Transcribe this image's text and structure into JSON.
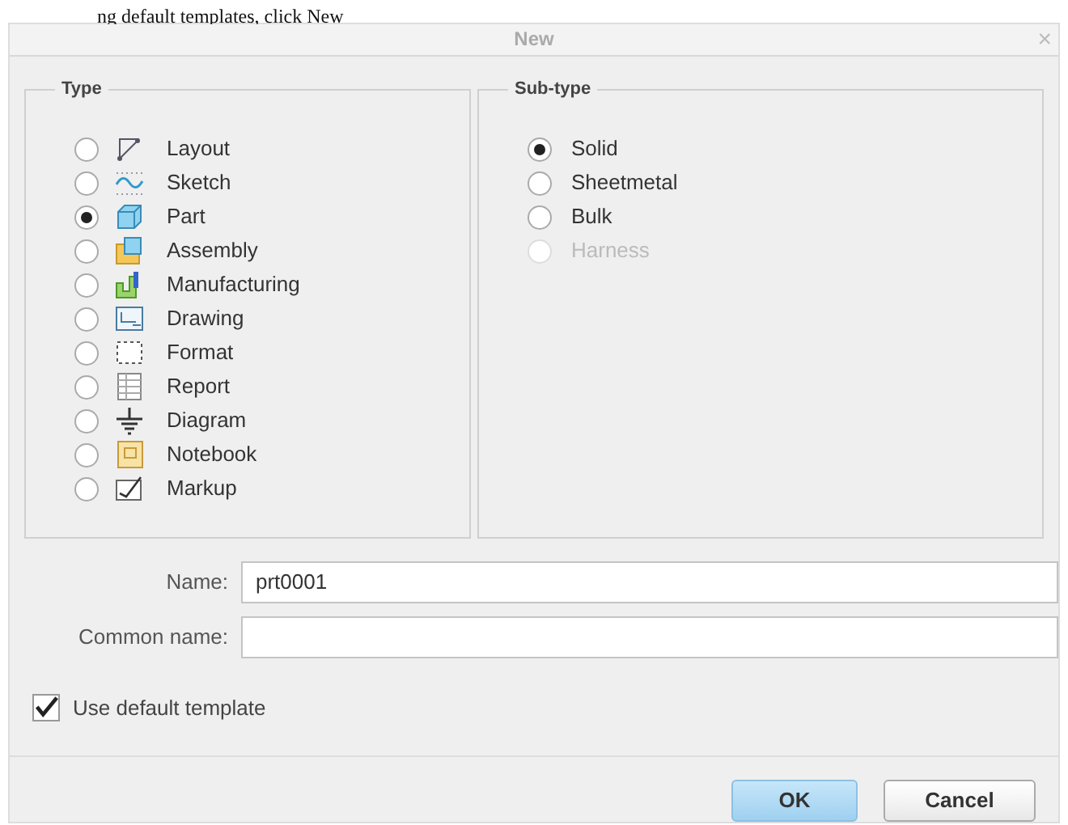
{
  "document_text": "ng default templates, click New",
  "window": {
    "title": "New",
    "close": "×"
  },
  "type_group": {
    "title": "Type",
    "items": [
      {
        "label": "Layout",
        "selected": false
      },
      {
        "label": "Sketch",
        "selected": false
      },
      {
        "label": "Part",
        "selected": true
      },
      {
        "label": "Assembly",
        "selected": false
      },
      {
        "label": "Manufacturing",
        "selected": false
      },
      {
        "label": "Drawing",
        "selected": false
      },
      {
        "label": "Format",
        "selected": false
      },
      {
        "label": "Report",
        "selected": false
      },
      {
        "label": "Diagram",
        "selected": false
      },
      {
        "label": "Notebook",
        "selected": false
      },
      {
        "label": "Markup",
        "selected": false
      }
    ]
  },
  "subtype_group": {
    "title": "Sub-type",
    "items": [
      {
        "label": "Solid",
        "selected": true,
        "disabled": false
      },
      {
        "label": "Sheetmetal",
        "selected": false,
        "disabled": false
      },
      {
        "label": "Bulk",
        "selected": false,
        "disabled": false
      },
      {
        "label": "Harness",
        "selected": false,
        "disabled": true
      }
    ]
  },
  "fields": [
    {
      "label": "Name:",
      "value": "prt0001"
    },
    {
      "label": "Common name:"
    }
  ],
  "use_default_template": {
    "label": "Use default template",
    "checked": true
  },
  "buttons": [
    {
      "label": "OK",
      "kind": "primary"
    },
    {
      "label": "Cancel",
      "kind": "secondary"
    }
  ]
}
